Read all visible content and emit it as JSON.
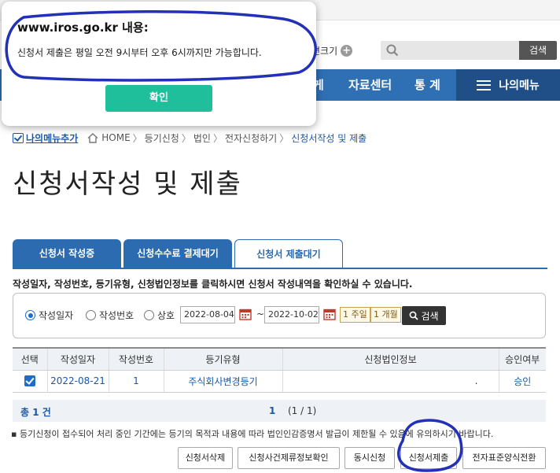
{
  "header": {
    "font_size_label": "면크기",
    "search_button": "검색"
  },
  "nav": {
    "items": [
      "게",
      "자료센터",
      "통 계"
    ],
    "my_menu": "나의메뉴"
  },
  "breadcrumb": {
    "my_menu_add": "나의메뉴추가",
    "items": [
      "HOME",
      "등기신청",
      "법인",
      "전자신청하기",
      "신청서작성 및 제출"
    ]
  },
  "page_title": "신청서작성 및 제출",
  "tabs": [
    "신청서 작성중",
    "신청수수료 결제대기",
    "신청서 제출대기"
  ],
  "guide_text": "작성일자, 작성번호, 등기유형, 신청법인정보를 클릭하시면 신청서 작성내역을 확인하실 수 있습니다.",
  "filter": {
    "options": [
      "작성일자",
      "작성번호",
      "상호"
    ],
    "selected": "작성일자",
    "date_from": "2022-08-04",
    "date_to": "2022-10-02",
    "tilde": "~",
    "week_btn": "1 주일",
    "month_btn": "1 개월",
    "search_btn": "검색"
  },
  "table": {
    "headers": [
      "선택",
      "작성일자",
      "작성번호",
      "등기유형",
      "신청법인정보",
      "승인여부"
    ],
    "rows": [
      {
        "date": "2022-08-21",
        "num": "1",
        "type": "주식회사변경등기",
        "info": ".",
        "approval": "승인"
      }
    ]
  },
  "pager": {
    "total": "총 1 건",
    "page": "1",
    "of": "(1 / 1)"
  },
  "notice": "등기신청이 접수되어 처리 중인 기간에는 등기의 목적과 내용에 따라 법인인감증명서 발급이 제한될 수 있음에 유의하시기 바랍니다.",
  "buttons": [
    "신청서삭제",
    "신청사건제류정보확인",
    "동시신청",
    "신청서제출",
    "전자표준양식전환"
  ],
  "dialog": {
    "title": "www.iros.go.kr 내용:",
    "message": "신청서 제출은  평일 오전 9시부터  오후 6시까지만 가능합니다.",
    "ok": "확인"
  },
  "colors": {
    "nav": "#2f6fb3",
    "my_menu": "#1f4f86",
    "ok_button": "#1fbf9c",
    "ink": "#2330b8"
  }
}
